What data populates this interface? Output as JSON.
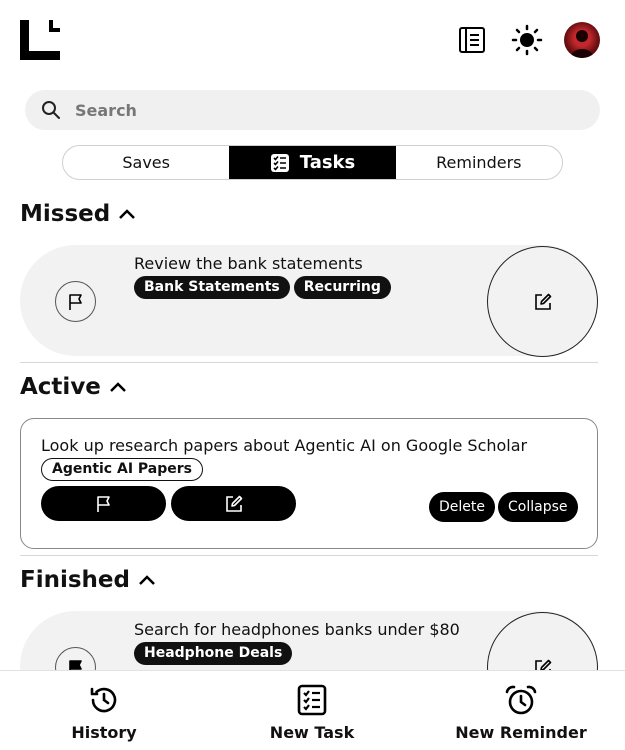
{
  "header": {
    "logo_icon": "corner-bracket-logo-icon",
    "notes_icon": "notebook-icon",
    "theme_icon": "sun-icon",
    "avatar_icon": "user-avatar"
  },
  "search": {
    "placeholder": "Search",
    "icon": "search-icon"
  },
  "tabs": [
    {
      "label": "Saves",
      "active": false
    },
    {
      "label": "Tasks",
      "active": true,
      "icon": "checklist-icon"
    },
    {
      "label": "Reminders",
      "active": false
    }
  ],
  "sections": {
    "missed": {
      "title": "Missed",
      "tasks": [
        {
          "title": "Review the bank statements",
          "tags": [
            "Bank Statements",
            "Recurring"
          ]
        }
      ]
    },
    "active": {
      "title": "Active",
      "tasks": [
        {
          "title": "Look up research papers about Agentic AI on Google Scholar",
          "tags": [
            "Agentic AI Papers"
          ],
          "delete_label": "Delete",
          "collapse_label": "Collapse"
        }
      ]
    },
    "finished": {
      "title": "Finished",
      "tasks": [
        {
          "title": "Search for headphones banks under $80",
          "tags": [
            "Headphone Deals"
          ]
        }
      ]
    }
  },
  "bottom_nav": [
    {
      "label": "History",
      "icon": "history-icon"
    },
    {
      "label": "New Task",
      "icon": "checklist-icon"
    },
    {
      "label": "New Reminder",
      "icon": "alarm-clock-icon"
    }
  ],
  "colors": {
    "primary": "#000000",
    "card_bg": "#f2f2f2",
    "search_bg": "#f0f0f0",
    "avatar": "#c0282d"
  }
}
